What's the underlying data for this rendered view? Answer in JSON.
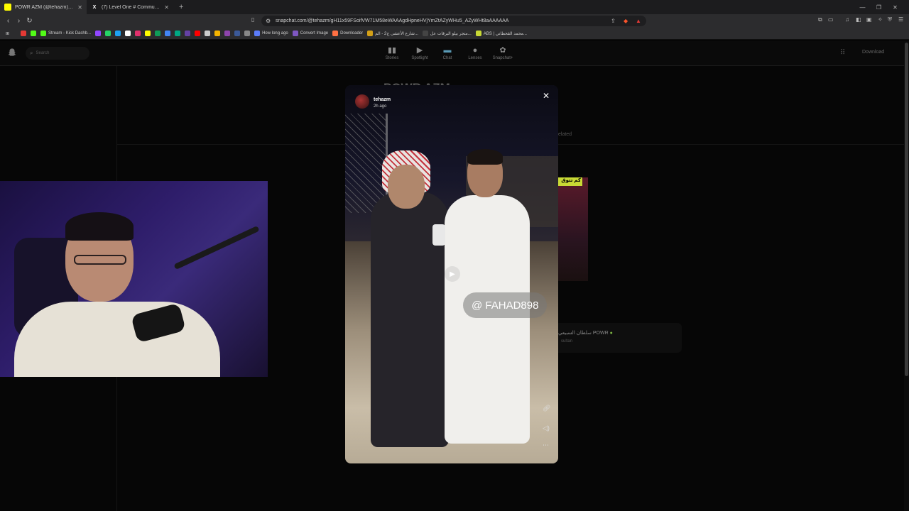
{
  "browser": {
    "tabs": [
      {
        "title": "POWR AZM (@tehazm) | Snapchat",
        "fav_letter": "",
        "fav_color": "#FFFC00",
        "active": true
      },
      {
        "title": "(7) Level One # Community / X",
        "fav_letter": "X",
        "fav_color": "#1c1c1e",
        "active": false
      }
    ],
    "new_tab": "+",
    "url": "snapchat.com/@tehazm/gH11x59FSoifVW71M58eWAAAgdHpneHVjYmZtAZyWHu5_AZyWHt8aAAAAAA",
    "bookmarks": [
      {
        "label": "",
        "color": "#e53935"
      },
      {
        "label": "",
        "color": "#53fc18"
      },
      {
        "label": "Stream - Kick Dashb...",
        "color": "#53fc18"
      },
      {
        "label": "",
        "color": "#9146ff"
      },
      {
        "label": "",
        "color": "#25d366"
      },
      {
        "label": "",
        "color": "#1da1f2"
      },
      {
        "label": "",
        "color": "#ffffff"
      },
      {
        "label": "",
        "color": "#e1306c"
      },
      {
        "label": "",
        "color": "#fffc00"
      },
      {
        "label": "",
        "color": "#0f9d58"
      },
      {
        "label": "",
        "color": "#4285f4"
      },
      {
        "label": "",
        "color": "#00a884"
      },
      {
        "label": "",
        "color": "#6441a5"
      },
      {
        "label": "",
        "color": "#ff0000"
      },
      {
        "label": "",
        "color": "#cccccc"
      },
      {
        "label": "",
        "color": "#f4b400"
      },
      {
        "label": "",
        "color": "#8e44ad"
      },
      {
        "label": "",
        "color": "#3b5998"
      },
      {
        "label": "",
        "color": "#888888"
      },
      {
        "label": "How long ago",
        "color": "#5b7cfa"
      },
      {
        "label": "Convert Image",
        "color": "#7e57c2"
      },
      {
        "label": "Downloader",
        "color": "#ff7043"
      },
      {
        "label": "شارع الأعشى ج2 - الم...",
        "color": "#d4a017"
      },
      {
        "label": "متجر بيلو البرقات عل...",
        "color": "#444444"
      },
      {
        "label": "ABS | محمد القحطاني...",
        "color": "#c8d935"
      }
    ]
  },
  "snapchat": {
    "search_placeholder": "Search",
    "nav": [
      {
        "label": "Stories",
        "icon": "stories-icon",
        "glyph": "▮▮"
      },
      {
        "label": "Spotlight",
        "icon": "spotlight-icon",
        "glyph": "▶"
      },
      {
        "label": "Chat",
        "icon": "chat-icon",
        "glyph": "▬"
      },
      {
        "label": "Lenses",
        "icon": "lenses-icon",
        "glyph": "●"
      },
      {
        "label": "Snapchat+",
        "icon": "snapchat-plus-icon",
        "glyph": "✿"
      }
    ],
    "download_label": "Download",
    "profile_name_fragment": "POWR AZM",
    "related_fragment": "elated",
    "thumb_label_fragment": "كم تتوق",
    "card_name": "سلطان السبيعي POWR",
    "card_user": "sultan"
  },
  "story": {
    "username": "tehazm",
    "time_ago": "2h ago",
    "mention": "@ FAHAD898",
    "close_glyph": "✕"
  },
  "colors": {
    "snap_yellow": "#FFFC00",
    "verified_green": "#7cb342"
  }
}
